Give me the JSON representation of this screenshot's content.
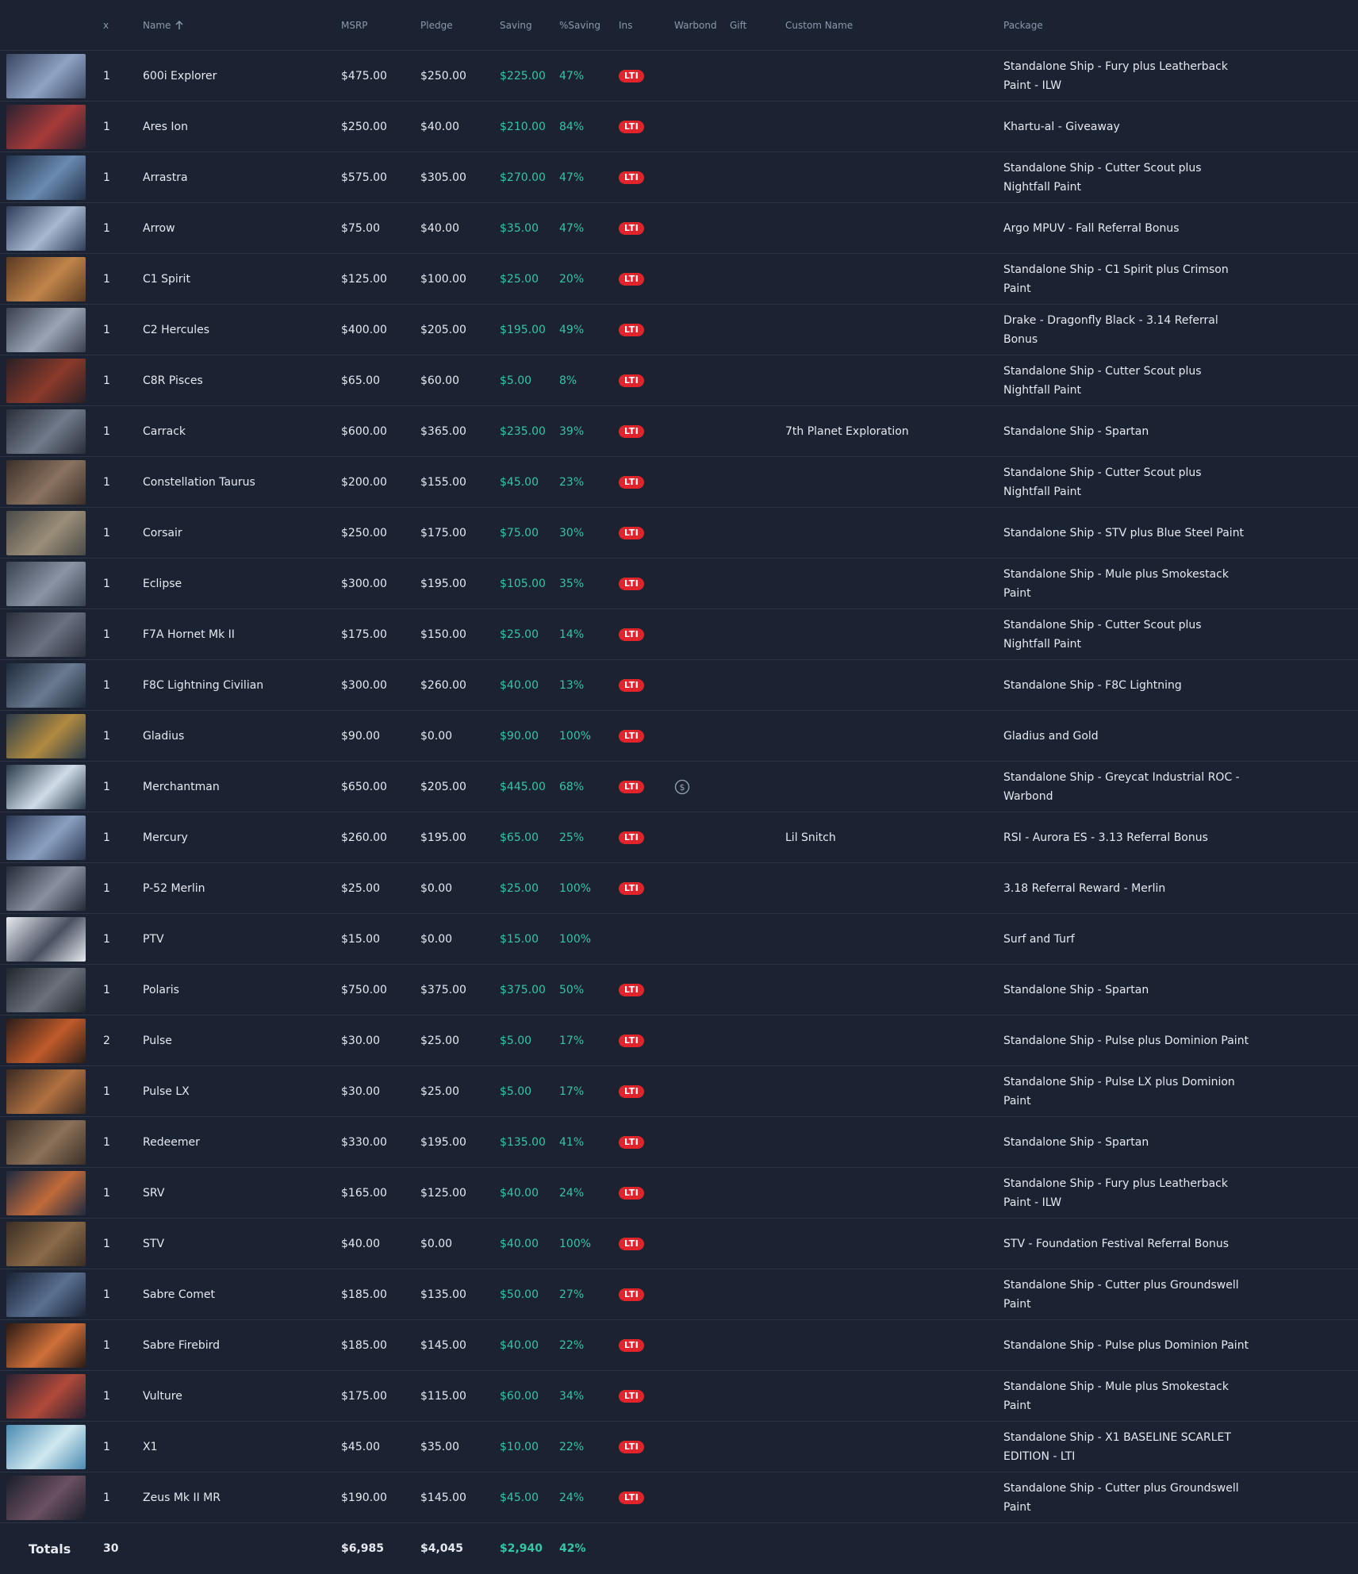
{
  "columns": {
    "x": "x",
    "name": "Name",
    "sort_icon": "arrow-up-icon",
    "msrp": "MSRP",
    "pledge": "Pledge",
    "saving": "Saving",
    "pct": "%Saving",
    "ins": "Ins",
    "warbond": "Warbond",
    "gift": "Gift",
    "custom": "Custom Name",
    "package": "Package"
  },
  "colors": {
    "background": "#1b2232",
    "accent_green": "#35c6a4",
    "lti_red": "#e0242c",
    "divider": "#2c3446"
  },
  "rows": [
    {
      "x": "1",
      "name": "600i Explorer",
      "msrp": "$475.00",
      "pledge": "$250.00",
      "saving": "$225.00",
      "pct": "47%",
      "lti": "LTI",
      "warbond": false,
      "custom": "",
      "package": "Standalone Ship - Fury plus Leatherback Paint - ILW"
    },
    {
      "x": "1",
      "name": "Ares Ion",
      "msrp": "$250.00",
      "pledge": "$40.00",
      "saving": "$210.00",
      "pct": "84%",
      "lti": "LTI",
      "warbond": false,
      "custom": "",
      "package": "Khartu-al - Giveaway"
    },
    {
      "x": "1",
      "name": "Arrastra",
      "msrp": "$575.00",
      "pledge": "$305.00",
      "saving": "$270.00",
      "pct": "47%",
      "lti": "LTI",
      "warbond": false,
      "custom": "",
      "package": "Standalone Ship - Cutter Scout plus Nightfall Paint"
    },
    {
      "x": "1",
      "name": "Arrow",
      "msrp": "$75.00",
      "pledge": "$40.00",
      "saving": "$35.00",
      "pct": "47%",
      "lti": "LTI",
      "warbond": false,
      "custom": "",
      "package": "Argo MPUV - Fall Referral Bonus"
    },
    {
      "x": "1",
      "name": "C1 Spirit",
      "msrp": "$125.00",
      "pledge": "$100.00",
      "saving": "$25.00",
      "pct": "20%",
      "lti": "LTI",
      "warbond": false,
      "custom": "",
      "package": "Standalone Ship - C1 Spirit plus Crimson Paint"
    },
    {
      "x": "1",
      "name": "C2 Hercules",
      "msrp": "$400.00",
      "pledge": "$205.00",
      "saving": "$195.00",
      "pct": "49%",
      "lti": "LTI",
      "warbond": false,
      "custom": "",
      "package": "Drake - Dragonfly Black - 3.14 Referral Bonus"
    },
    {
      "x": "1",
      "name": "C8R Pisces",
      "msrp": "$65.00",
      "pledge": "$60.00",
      "saving": "$5.00",
      "pct": "8%",
      "lti": "LTI",
      "warbond": false,
      "custom": "",
      "package": "Standalone Ship - Cutter Scout plus Nightfall Paint"
    },
    {
      "x": "1",
      "name": "Carrack",
      "msrp": "$600.00",
      "pledge": "$365.00",
      "saving": "$235.00",
      "pct": "39%",
      "lti": "LTI",
      "warbond": false,
      "custom": "7th Planet Exploration",
      "package": "Standalone Ship - Spartan"
    },
    {
      "x": "1",
      "name": "Constellation Taurus",
      "msrp": "$200.00",
      "pledge": "$155.00",
      "saving": "$45.00",
      "pct": "23%",
      "lti": "LTI",
      "warbond": false,
      "custom": "",
      "package": "Standalone Ship - Cutter Scout plus Nightfall Paint"
    },
    {
      "x": "1",
      "name": "Corsair",
      "msrp": "$250.00",
      "pledge": "$175.00",
      "saving": "$75.00",
      "pct": "30%",
      "lti": "LTI",
      "warbond": false,
      "custom": "",
      "package": "Standalone Ship - STV plus Blue Steel Paint"
    },
    {
      "x": "1",
      "name": "Eclipse",
      "msrp": "$300.00",
      "pledge": "$195.00",
      "saving": "$105.00",
      "pct": "35%",
      "lti": "LTI",
      "warbond": false,
      "custom": "",
      "package": "Standalone Ship - Mule plus Smokestack Paint"
    },
    {
      "x": "1",
      "name": "F7A Hornet Mk II",
      "msrp": "$175.00",
      "pledge": "$150.00",
      "saving": "$25.00",
      "pct": "14%",
      "lti": "LTI",
      "warbond": false,
      "custom": "",
      "package": "Standalone Ship - Cutter Scout plus Nightfall Paint"
    },
    {
      "x": "1",
      "name": "F8C Lightning Civilian",
      "msrp": "$300.00",
      "pledge": "$260.00",
      "saving": "$40.00",
      "pct": "13%",
      "lti": "LTI",
      "warbond": false,
      "custom": "",
      "package": "Standalone Ship - F8C Lightning"
    },
    {
      "x": "1",
      "name": "Gladius",
      "msrp": "$90.00",
      "pledge": "$0.00",
      "saving": "$90.00",
      "pct": "100%",
      "lti": "LTI",
      "warbond": false,
      "custom": "",
      "package": "Gladius and Gold"
    },
    {
      "x": "1",
      "name": "Merchantman",
      "msrp": "$650.00",
      "pledge": "$205.00",
      "saving": "$445.00",
      "pct": "68%",
      "lti": "LTI",
      "warbond": true,
      "custom": "",
      "package": "Standalone Ship - Greycat Industrial ROC - Warbond"
    },
    {
      "x": "1",
      "name": "Mercury",
      "msrp": "$260.00",
      "pledge": "$195.00",
      "saving": "$65.00",
      "pct": "25%",
      "lti": "LTI",
      "warbond": false,
      "custom": "Lil Snitch",
      "package": "RSI - Aurora ES - 3.13 Referral Bonus"
    },
    {
      "x": "1",
      "name": "P-52 Merlin",
      "msrp": "$25.00",
      "pledge": "$0.00",
      "saving": "$25.00",
      "pct": "100%",
      "lti": "LTI",
      "warbond": false,
      "custom": "",
      "package": "3.18 Referral Reward - Merlin"
    },
    {
      "x": "1",
      "name": "PTV",
      "msrp": "$15.00",
      "pledge": "$0.00",
      "saving": "$15.00",
      "pct": "100%",
      "lti": "",
      "warbond": false,
      "custom": "",
      "package": "Surf and Turf"
    },
    {
      "x": "1",
      "name": "Polaris",
      "msrp": "$750.00",
      "pledge": "$375.00",
      "saving": "$375.00",
      "pct": "50%",
      "lti": "LTI",
      "warbond": false,
      "custom": "",
      "package": "Standalone Ship - Spartan"
    },
    {
      "x": "2",
      "name": "Pulse",
      "msrp": "$30.00",
      "pledge": "$25.00",
      "saving": "$5.00",
      "pct": "17%",
      "lti": "LTI",
      "warbond": false,
      "custom": "",
      "package": "Standalone Ship - Pulse plus Dominion Paint"
    },
    {
      "x": "1",
      "name": "Pulse LX",
      "msrp": "$30.00",
      "pledge": "$25.00",
      "saving": "$5.00",
      "pct": "17%",
      "lti": "LTI",
      "warbond": false,
      "custom": "",
      "package": "Standalone Ship - Pulse LX plus Dominion Paint"
    },
    {
      "x": "1",
      "name": "Redeemer",
      "msrp": "$330.00",
      "pledge": "$195.00",
      "saving": "$135.00",
      "pct": "41%",
      "lti": "LTI",
      "warbond": false,
      "custom": "",
      "package": "Standalone Ship - Spartan"
    },
    {
      "x": "1",
      "name": "SRV",
      "msrp": "$165.00",
      "pledge": "$125.00",
      "saving": "$40.00",
      "pct": "24%",
      "lti": "LTI",
      "warbond": false,
      "custom": "",
      "package": "Standalone Ship - Fury plus Leatherback Paint - ILW"
    },
    {
      "x": "1",
      "name": "STV",
      "msrp": "$40.00",
      "pledge": "$0.00",
      "saving": "$40.00",
      "pct": "100%",
      "lti": "LTI",
      "warbond": false,
      "custom": "",
      "package": "STV - Foundation Festival Referral Bonus"
    },
    {
      "x": "1",
      "name": "Sabre Comet",
      "msrp": "$185.00",
      "pledge": "$135.00",
      "saving": "$50.00",
      "pct": "27%",
      "lti": "LTI",
      "warbond": false,
      "custom": "",
      "package": "Standalone Ship - Cutter plus Groundswell Paint"
    },
    {
      "x": "1",
      "name": "Sabre Firebird",
      "msrp": "$185.00",
      "pledge": "$145.00",
      "saving": "$40.00",
      "pct": "22%",
      "lti": "LTI",
      "warbond": false,
      "custom": "",
      "package": "Standalone Ship - Pulse plus Dominion Paint"
    },
    {
      "x": "1",
      "name": "Vulture",
      "msrp": "$175.00",
      "pledge": "$115.00",
      "saving": "$60.00",
      "pct": "34%",
      "lti": "LTI",
      "warbond": false,
      "custom": "",
      "package": "Standalone Ship - Mule plus Smokestack Paint"
    },
    {
      "x": "1",
      "name": "X1",
      "msrp": "$45.00",
      "pledge": "$35.00",
      "saving": "$10.00",
      "pct": "22%",
      "lti": "LTI",
      "warbond": false,
      "custom": "",
      "package": "Standalone Ship - X1 BASELINE SCARLET EDITION - LTI"
    },
    {
      "x": "1",
      "name": "Zeus Mk II MR",
      "msrp": "$190.00",
      "pledge": "$145.00",
      "saving": "$45.00",
      "pct": "24%",
      "lti": "LTI",
      "warbond": false,
      "custom": "",
      "package": "Standalone Ship - Cutter plus Groundswell Paint"
    }
  ],
  "totals": {
    "label": "Totals",
    "x": "30",
    "msrp": "$6,985",
    "pledge": "$4,045",
    "saving": "$2,940",
    "pct": "42%"
  }
}
